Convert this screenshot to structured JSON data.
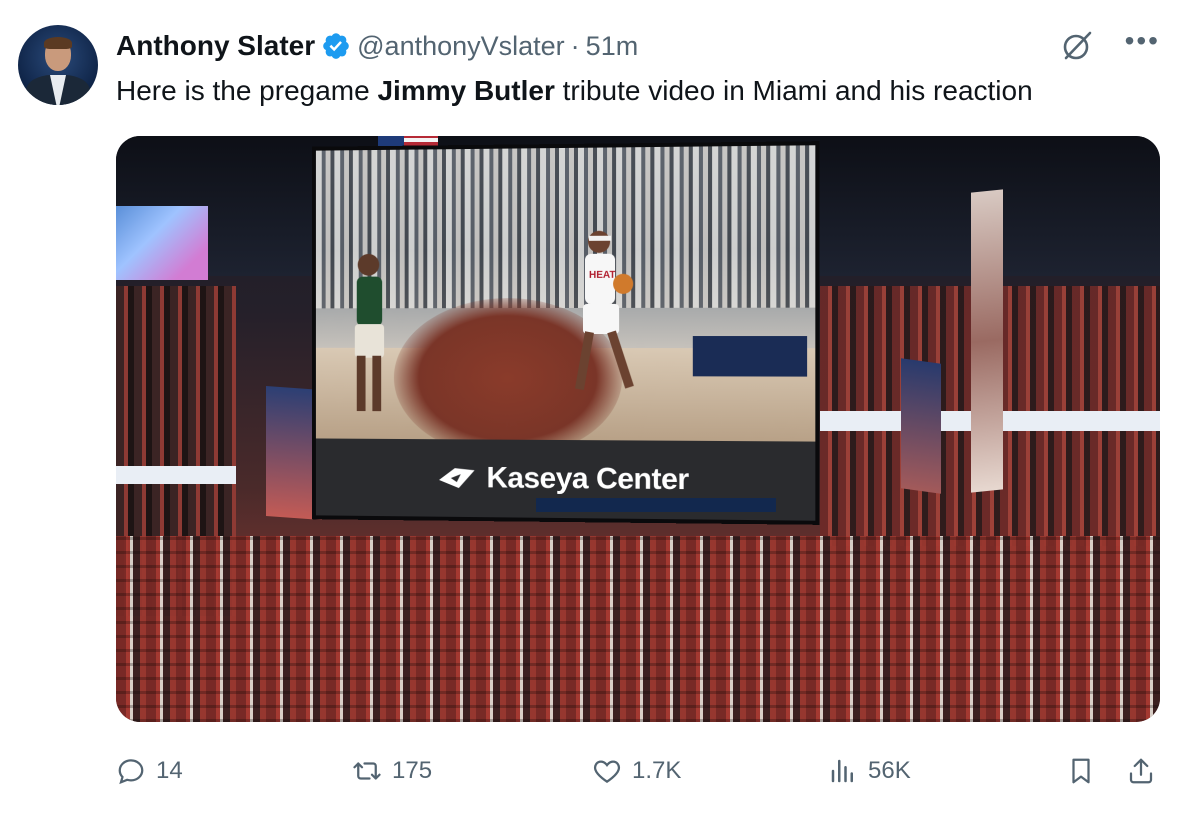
{
  "author": {
    "name": "Anthony Slater",
    "handle": "@anthonyVslater",
    "separator": "·",
    "time": "51m"
  },
  "tweet": {
    "text_before": "Here is the pregame ",
    "text_bold": "Jimmy Butler",
    "text_after": " tribute video in Miami and his reaction"
  },
  "media": {
    "jumbotron_sponsor": "Kaseya Center"
  },
  "actions": {
    "replies": "14",
    "reposts": "175",
    "likes": "1.7K",
    "views": "56K"
  },
  "icons": [
    "verified-badge-icon",
    "grok-icon",
    "more-icon",
    "reply-icon",
    "repost-icon",
    "like-icon",
    "views-icon",
    "bookmark-icon",
    "share-icon"
  ],
  "colors": {
    "verified": "#1d9bf0",
    "text": "#0f1419",
    "muted": "#536471"
  }
}
